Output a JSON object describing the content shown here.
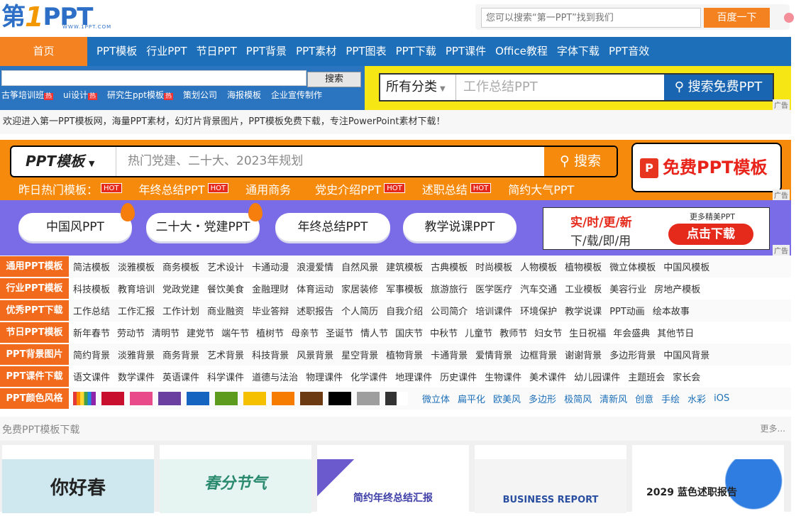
{
  "logo": {
    "main": "第",
    "one": "1",
    "ppt": "PPT",
    "sub": "WWW.1PPT.COM"
  },
  "top_search": {
    "placeholder": "您可以搜索“第一PPT”找到我们",
    "button": "百度一下"
  },
  "nav": {
    "home": "首页",
    "items": [
      "PPT模板",
      "行业PPT",
      "节日PPT",
      "PPT背景",
      "PPT素材",
      "PPT图表",
      "PPT下载",
      "PPT课件",
      "Office教程",
      "字体下载",
      "PPT音效"
    ]
  },
  "search_left": {
    "button": "搜索",
    "hot": [
      "古筝培训班",
      "ui设计",
      "研究生ppt模板",
      "策划公司",
      "海报模板",
      "企业宣传制作"
    ],
    "hot_badge": "热"
  },
  "search_right": {
    "category": "所有分类",
    "placeholder": "工作总结PPT",
    "button": "搜索免费PPT",
    "ad": "广告"
  },
  "welcome": "欢迎进入第一PPT模板网，海量PPT素材，幻灯片背景图片，PPT模板免费下载，专注PowerPoint素材下载！",
  "orange_banner": {
    "type": "PPT模板",
    "placeholder": "热门党建、二十大、2023年规划",
    "button": "搜索",
    "hot_label": "昨日热门模板：",
    "hot_badge": "HOT",
    "links": [
      "年终总结PPT",
      "通用商务",
      "党史介绍PPT",
      "述职总结",
      "简约大气PPT"
    ],
    "free": "免费PPT模板",
    "ad": "广告"
  },
  "purple_banner": {
    "pills": [
      "中国风PPT",
      "二十大・党建PPT",
      "年终总结PPT",
      "教学说课PPT"
    ],
    "dl_line1": "实/时/更/新",
    "dl_line2": "下/载/即/用",
    "dl_more": "更多精美PPT",
    "dl_button": "点击下载",
    "ad": "广告"
  },
  "categories": [
    {
      "tag": "通用PPT模板",
      "links": [
        "简洁模板",
        "淡雅模板",
        "商务模板",
        "艺术设计",
        "卡通动漫",
        "浪漫爱情",
        "自然风景",
        "建筑模板",
        "古典模板",
        "时尚模板",
        "人物模板",
        "植物模板",
        "微立体模板",
        "中国风模板"
      ]
    },
    {
      "tag": "行业PPT模板",
      "links": [
        "科技模板",
        "教育培训",
        "党政党建",
        "餐饮美食",
        "金融理财",
        "体育运动",
        "家居装修",
        "军事模板",
        "旅游旅行",
        "医学医疗",
        "汽车交通",
        "工业模板",
        "美容行业",
        "房地产模板"
      ]
    },
    {
      "tag": "优秀PPT下载",
      "links": [
        "工作总结",
        "工作汇报",
        "工作计划",
        "商业融资",
        "毕业答辩",
        "述职报告",
        "个人简历",
        "自我介绍",
        "公司简介",
        "培训课件",
        "环境保护",
        "教学说课",
        "PPT动画",
        "绘本故事"
      ]
    },
    {
      "tag": "节日PPT模板",
      "links": [
        "新年春节",
        "劳动节",
        "清明节",
        "建党节",
        "端午节",
        "植树节",
        "母亲节",
        "圣诞节",
        "情人节",
        "国庆节",
        "中秋节",
        "儿童节",
        "教师节",
        "妇女节",
        "生日祝福",
        "年会盛典",
        "其他节日"
      ]
    },
    {
      "tag": "PPT背景图片",
      "links": [
        "简约背景",
        "淡雅背景",
        "商务背景",
        "艺术背景",
        "科技背景",
        "风景背景",
        "星空背景",
        "植物背景",
        "卡通背景",
        "爱情背景",
        "边框背景",
        "谢谢背景",
        "多边形背景",
        "中国风背景"
      ]
    },
    {
      "tag": "PPT课件下载",
      "links": [
        "语文课件",
        "数学课件",
        "英语课件",
        "科学课件",
        "道德与法治",
        "物理课件",
        "化学课件",
        "地理课件",
        "历史课件",
        "生物课件",
        "美术课件",
        "幼儿园课件",
        "主题班会",
        "家长会"
      ]
    }
  ],
  "colors": {
    "tag": "PPT颜色风格",
    "swatches": [
      "#c8102e",
      "#e84a8a",
      "#6b3fa0",
      "#1565c0",
      "#5d9b1e",
      "#f5c000",
      "#f57c00",
      "#6b3a12",
      "#000000",
      "#9e9e9e",
      "#333333"
    ],
    "styles": [
      "微立体",
      "扁平化",
      "欧美风",
      "多边形",
      "极简风",
      "清新风",
      "创意",
      "手绘",
      "水彩",
      "iOS"
    ]
  },
  "free_section": {
    "title": "免费PPT模板下载",
    "more": "更多..."
  },
  "thumbs": [
    {
      "caption": "你好春",
      "bg": "#cfe8ef"
    },
    {
      "caption": "春分节气",
      "bg": "#e6f4f2"
    },
    {
      "caption": "简约年终总结汇报",
      "bg": "#ffffff"
    },
    {
      "caption": "BUSINESS REPORT",
      "bg": "#f4f4f4"
    },
    {
      "caption": "2029 蓝色述职报告",
      "bg": "#ffffff"
    }
  ]
}
